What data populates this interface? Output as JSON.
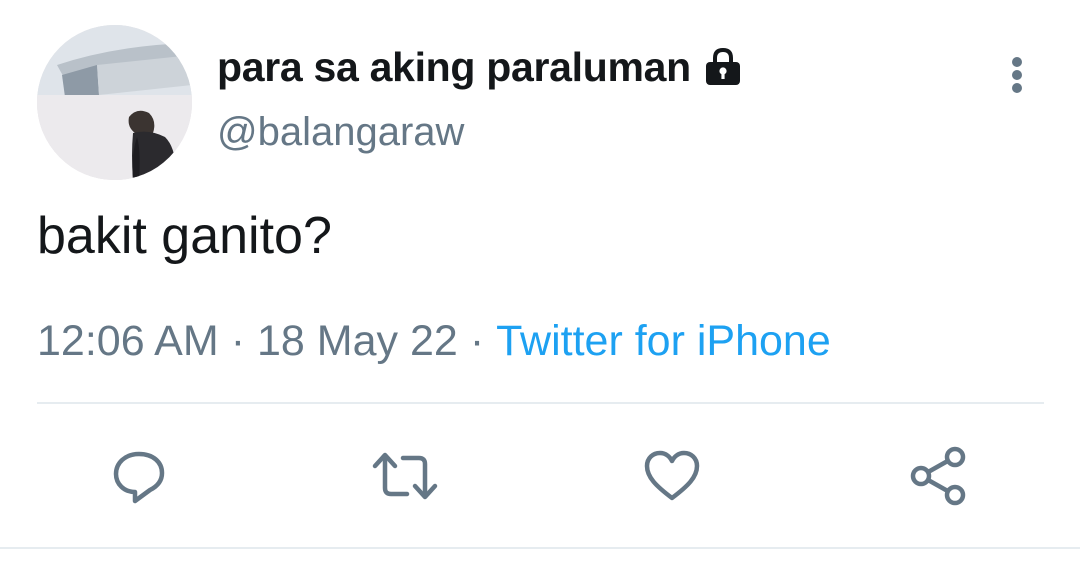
{
  "tweet": {
    "display_name": "para sa aking paraluman",
    "handle": "@balangaraw",
    "text": "bakit ganito?",
    "time": "12:06 AM",
    "date": "18 May 22",
    "source": "Twitter for iPhone",
    "separator": "·",
    "is_protected": true
  },
  "icons": {
    "protected": "lock-icon",
    "more": "more-vertical-icon",
    "reply": "reply-icon",
    "retweet": "retweet-icon",
    "like": "heart-icon",
    "share": "share-icon"
  },
  "colors": {
    "text": "#14171a",
    "secondary": "#657786",
    "accent": "#1da1f2",
    "divider": "#e6ecf0"
  }
}
